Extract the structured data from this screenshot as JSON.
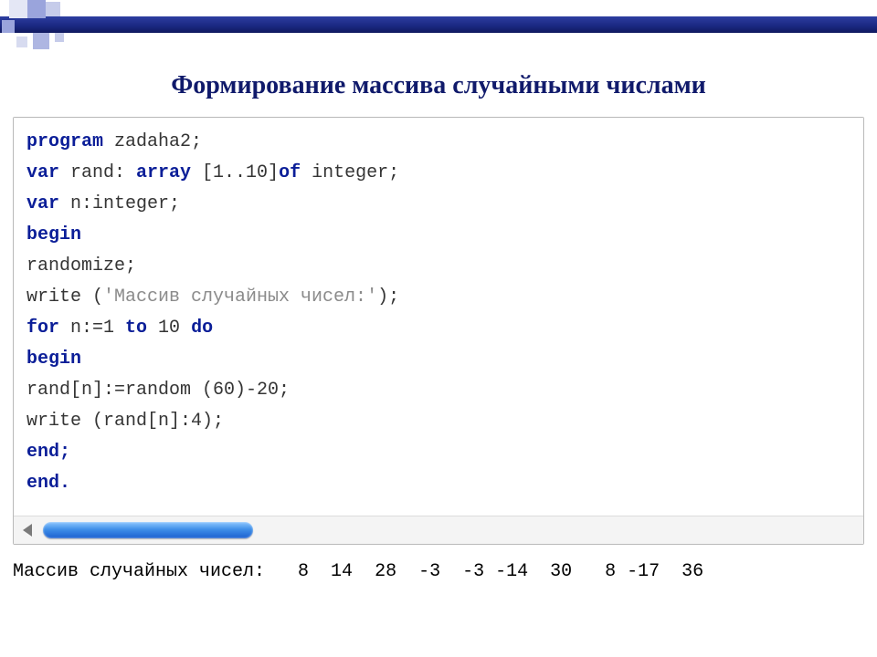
{
  "title": "Формирование массива случайными числами",
  "code": {
    "lines": [
      [
        {
          "t": "program ",
          "c": "kw"
        },
        {
          "t": "zadaha2;",
          "c": ""
        }
      ],
      [
        {
          "t": "var ",
          "c": "kw"
        },
        {
          "t": "rand: ",
          "c": ""
        },
        {
          "t": "array ",
          "c": "kw"
        },
        {
          "t": "[1..10]",
          "c": ""
        },
        {
          "t": "of ",
          "c": "kw"
        },
        {
          "t": "integer;",
          "c": ""
        }
      ],
      [
        {
          "t": "var ",
          "c": "kw"
        },
        {
          "t": "n:integer;",
          "c": ""
        }
      ],
      [
        {
          "t": "begin",
          "c": "kw"
        }
      ],
      [
        {
          "t": "randomize;",
          "c": ""
        }
      ],
      [
        {
          "t": "write (",
          "c": ""
        },
        {
          "t": "'Массив случайных чисел:'",
          "c": "str"
        },
        {
          "t": ");",
          "c": ""
        }
      ],
      [
        {
          "t": "for ",
          "c": "kw"
        },
        {
          "t": "n:=1 ",
          "c": ""
        },
        {
          "t": "to ",
          "c": "kw"
        },
        {
          "t": "10 ",
          "c": ""
        },
        {
          "t": "do",
          "c": "kw"
        }
      ],
      [
        {
          "t": "begin",
          "c": "kw"
        }
      ],
      [
        {
          "t": "rand[n]:=random (60)-20;",
          "c": ""
        }
      ],
      [
        {
          "t": "write (rand[n]:4);",
          "c": ""
        }
      ],
      [
        {
          "t": "end;",
          "c": "kw"
        }
      ],
      [
        {
          "t": "end.",
          "c": "kw"
        }
      ]
    ]
  },
  "output": {
    "label": "Массив случайных чисел:",
    "values": [
      8,
      14,
      28,
      -3,
      -3,
      -14,
      30,
      8,
      -17,
      36
    ],
    "rendered": "Массив случайных чисел:   8  14  28  -3  -3 -14  30   8 -17  36"
  }
}
